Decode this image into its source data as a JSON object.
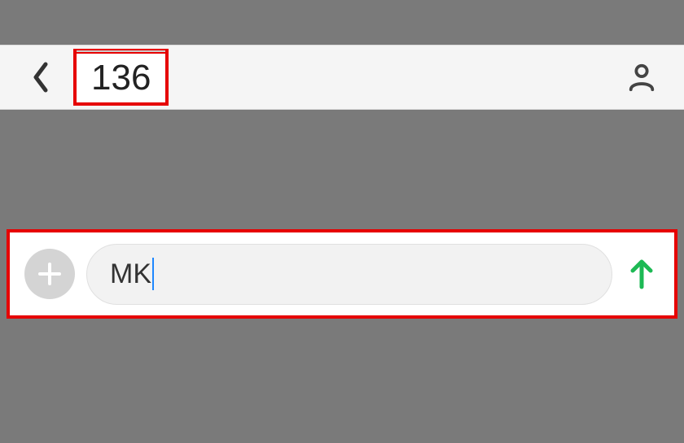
{
  "header": {
    "title": "136"
  },
  "compose": {
    "input_value": "MK"
  },
  "icons": {
    "back": "back-chevron",
    "profile": "person",
    "plus": "plus",
    "send": "arrow-up"
  },
  "colors": {
    "highlight": "#e60000",
    "send_accent": "#1db954",
    "cursor": "#1e88ff"
  }
}
